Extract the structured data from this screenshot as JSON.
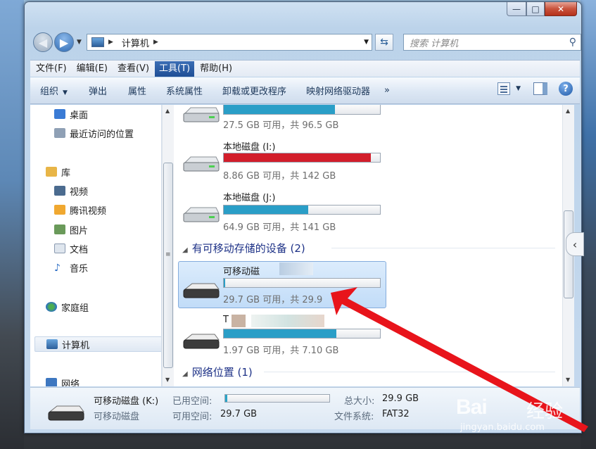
{
  "window": {
    "title_buttons": {
      "minimize": "—",
      "maximize": "□",
      "close": "✕"
    }
  },
  "address": {
    "crumb": "计算机",
    "search_placeholder": "搜索 计算机"
  },
  "menu": [
    "文件(F)",
    "编辑(E)",
    "查看(V)",
    "工具(T)",
    "帮助(H)"
  ],
  "menu_active": "工具(T)",
  "commands": {
    "organize": "组织",
    "eject": "弹出",
    "properties": "属性",
    "system_properties": "系统属性",
    "uninstall": "卸载或更改程序",
    "map_drive": "映射网络驱动器",
    "more": "»"
  },
  "nav": {
    "desktop": "桌面",
    "recent": "最近访问的位置",
    "libraries": "库",
    "video": "视频",
    "tencent_video": "腾讯视频",
    "pictures": "图片",
    "documents": "文档",
    "music": "音乐",
    "homegroup": "家庭组",
    "computer": "计算机",
    "network": "网络"
  },
  "drives": {
    "top": {
      "free": "27.5 GB 可用，共 96.5 GB",
      "fill": 0.71,
      "color": "#2a9ec7"
    },
    "i": {
      "name": "本地磁盘 (I:)",
      "free": "8.86 GB 可用，共 142 GB",
      "fill": 0.94,
      "color": "#d21e2b"
    },
    "j": {
      "name": "本地磁盘 (J:)",
      "free": "64.9 GB 可用，共 141 GB",
      "fill": 0.54,
      "color": "#2a9ec7"
    }
  },
  "groups": {
    "removable": "有可移动存储的设备 (2)",
    "network": "网络位置 (1)"
  },
  "removable": {
    "k": {
      "name": "可移动磁",
      "free": "29.7 GB 可用，共 29.9",
      "fill": 0.01,
      "color": "#2a9ec7"
    },
    "t": {
      "name": "T",
      "free": "1.97 GB 可用，共 7.10 GB",
      "fill": 0.72,
      "color": "#2a9ec7"
    }
  },
  "details": {
    "name": "可移动磁盘 (K:)",
    "type": "可移动磁盘",
    "used_label": "已用空间:",
    "free_label": "可用空间:",
    "free_value": "29.7 GB",
    "total_label": "总大小:",
    "total_value": "29.9 GB",
    "fs_label": "文件系统:",
    "fs_value": "FAT32",
    "used_fill": 0.01
  },
  "watermark": {
    "logo": "Bai",
    "logo2": "经验",
    "url": "jingyan.baidu.com"
  }
}
